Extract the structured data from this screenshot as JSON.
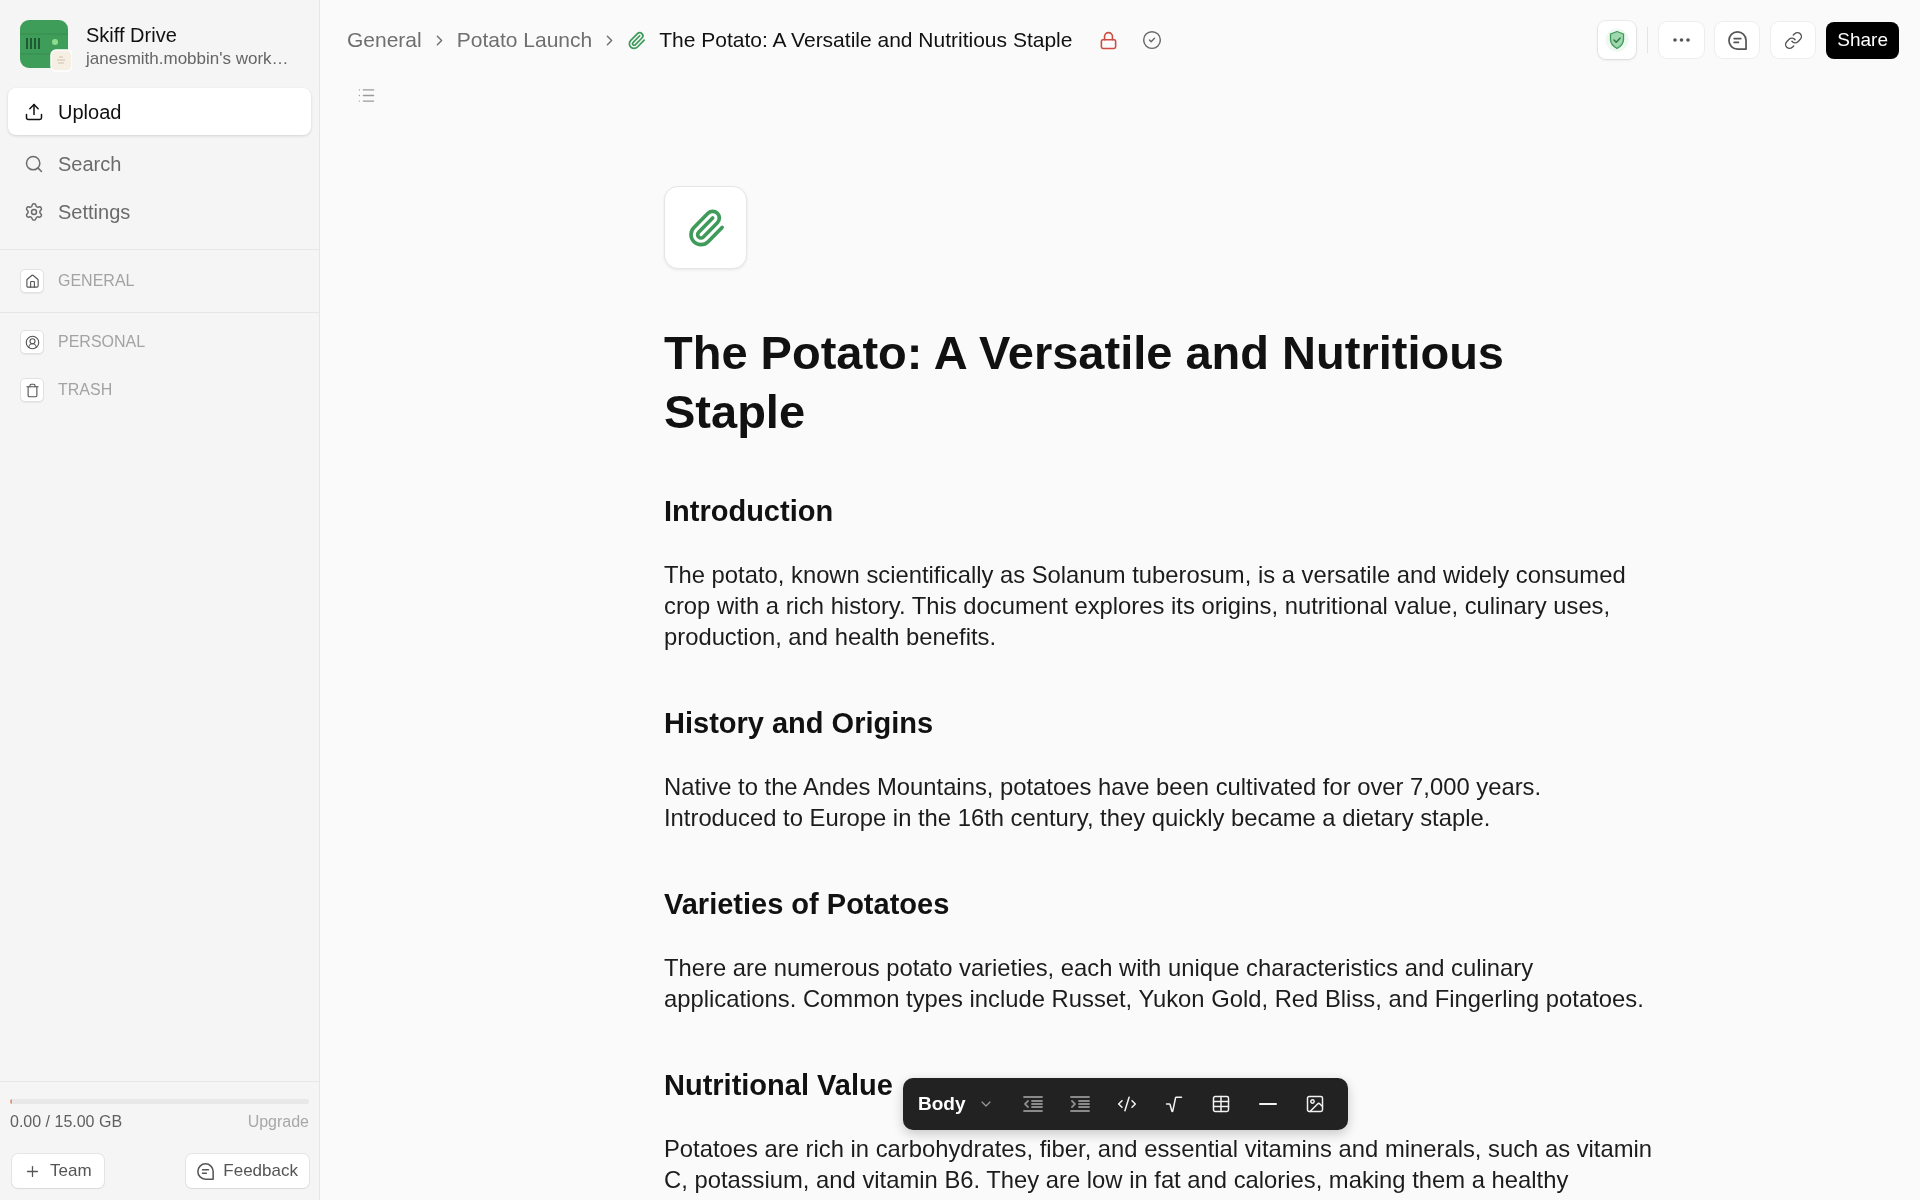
{
  "sidebar": {
    "workspace": {
      "name": "Skiff Drive",
      "subtitle": "janesmith.mobbin's work…"
    },
    "actions": [
      {
        "label": "Upload",
        "kind": "primary"
      },
      {
        "label": "Search",
        "kind": "plain"
      },
      {
        "label": "Settings",
        "kind": "plain"
      }
    ],
    "section_groups": [
      {
        "items": [
          {
            "label": "GENERAL"
          }
        ]
      },
      {
        "items": [
          {
            "label": "PERSONAL"
          },
          {
            "label": "TRASH"
          }
        ]
      }
    ],
    "storage": {
      "usage": "0.00 / 15.00 GB",
      "level": 0.007,
      "upgrade": "Upgrade"
    },
    "footer_buttons": [
      {
        "label": "Team"
      },
      {
        "label": "Feedback"
      }
    ]
  },
  "header": {
    "breadcrumbs": [
      "General",
      "Potato Launch"
    ],
    "title": "The Potato: A Versatile and Nutritious Staple",
    "share": "Share"
  },
  "document": {
    "title": "The Potato: A Versatile and Nutritious Staple",
    "sections": [
      {
        "heading": "Introduction",
        "paragraph": "The potato, known scientifically as Solanum tuberosum, is a versatile and widely consumed crop with a rich history. This document explores its origins, nutritional value, culinary uses, production, and health benefits."
      },
      {
        "heading": "History and Origins",
        "paragraph": "Native to the Andes Mountains, potatoes have been cultivated for over 7,000 years. Introduced to Europe in the 16th century, they quickly became a dietary staple."
      },
      {
        "heading": "Varieties of Potatoes",
        "paragraph": "There are numerous potato varieties, each with unique characteristics and culinary applications. Common types include Russet, Yukon Gold, Red Bliss, and Fingerling potatoes."
      },
      {
        "heading": "Nutritional Value",
        "paragraph": "Potatoes are rich in carbohydrates, fiber, and essential vitamins and minerals, such as vitamin C, potassium, and vitamin B6. They are low in fat and calories, making them a healthy"
      }
    ]
  },
  "format_toolbar": {
    "style": "Body",
    "buttons": [
      {
        "disabled": true
      },
      {
        "disabled": true
      },
      {
        "disabled": false
      },
      {
        "disabled": false
      },
      {
        "disabled": false
      },
      {
        "disabled": false
      },
      {
        "disabled": false
      }
    ]
  }
}
